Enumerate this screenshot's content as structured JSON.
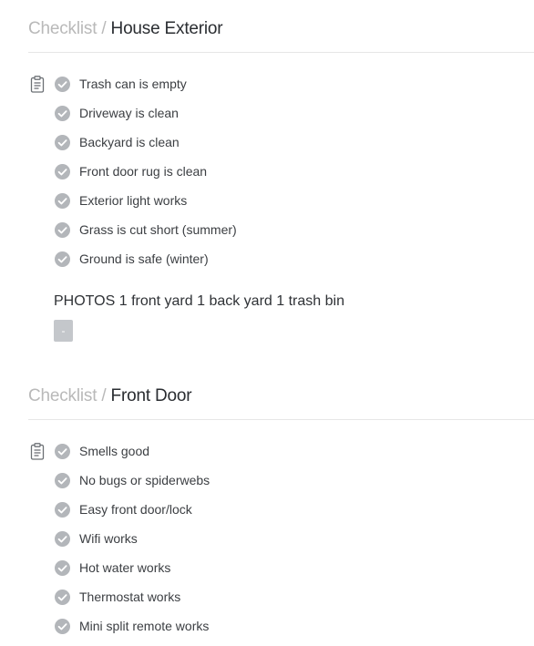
{
  "sections": [
    {
      "breadcrumb": "Checklist",
      "separator": "/",
      "title": "House Exterior",
      "items": [
        {
          "label": "Trash can is empty",
          "checked": true
        },
        {
          "label": "Driveway is clean",
          "checked": true
        },
        {
          "label": "Backyard is clean",
          "checked": true
        },
        {
          "label": "Front door rug is clean",
          "checked": true
        },
        {
          "label": "Exterior light works",
          "checked": true
        },
        {
          "label": "Grass is cut short (summer)",
          "checked": true
        },
        {
          "label": "Ground is safe (winter)",
          "checked": true
        }
      ],
      "photos_label": "PHOTOS 1 front yard 1 back yard 1 trash bin",
      "photo_chip_text": "-"
    },
    {
      "breadcrumb": "Checklist",
      "separator": "/",
      "title": "Front Door",
      "items": [
        {
          "label": "Smells good",
          "checked": true
        },
        {
          "label": "No bugs or spiderwebs",
          "checked": true
        },
        {
          "label": "Easy front door/lock",
          "checked": true
        },
        {
          "label": "Wifi works",
          "checked": true
        },
        {
          "label": "Hot water works",
          "checked": true
        },
        {
          "label": "Thermostat works",
          "checked": true
        },
        {
          "label": "Mini split remote works",
          "checked": true
        }
      ]
    }
  ],
  "icons": {
    "checklist": "clipboard-icon",
    "check": "check-circle-icon"
  },
  "colors": {
    "check_fill": "#b3b6ba",
    "crumb": "#b9b9b9",
    "title": "#2a2d31",
    "chip": "#c4c7cb"
  }
}
